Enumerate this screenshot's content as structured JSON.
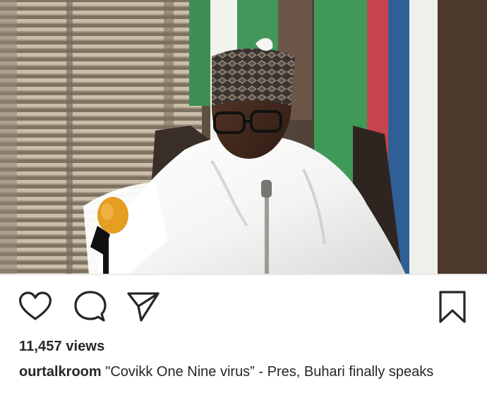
{
  "post": {
    "media": {
      "type": "video",
      "subject": "man in white agbada and patterned cap speaking into microphones before a green-white flag"
    },
    "actions": {
      "like_icon": "heart-icon",
      "comment_icon": "comment-icon",
      "share_icon": "send-icon",
      "save_icon": "bookmark-icon"
    },
    "stats": {
      "views": "11,457 views"
    },
    "caption": {
      "username": "ourtalkroom",
      "text": " \"Covikk One Nine virus” - Pres, Buhari finally speaks"
    },
    "colors": {
      "text": "#262626",
      "flag_green": "#3f9a57",
      "flag_red": "#c8444d",
      "flag_blue": "#2f5f95",
      "microphone_foam": "#e59d22"
    }
  }
}
